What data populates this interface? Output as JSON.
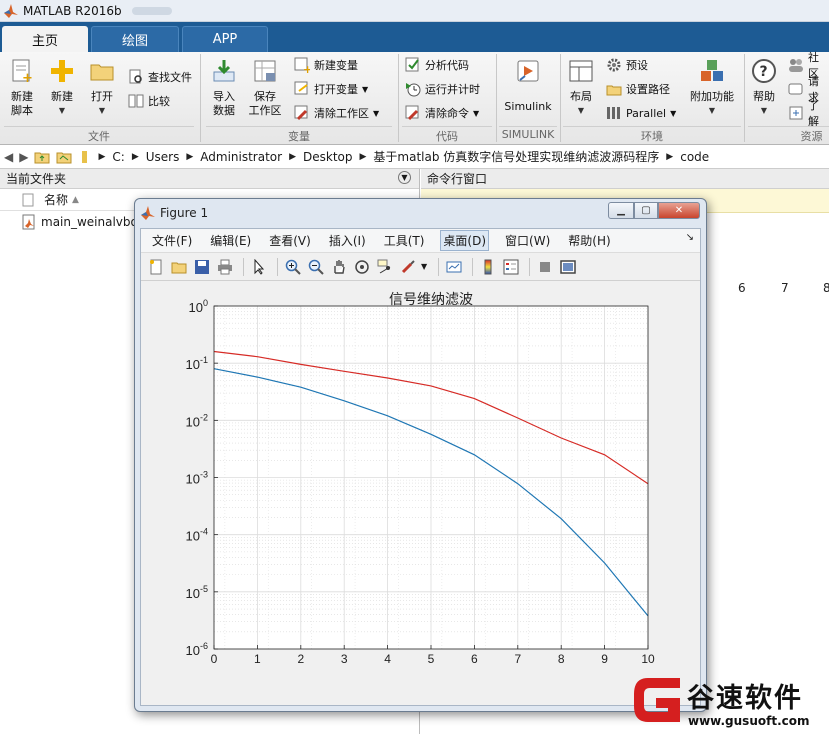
{
  "app": {
    "title": "MATLAB R2016b"
  },
  "tabs": [
    {
      "label": "主页"
    },
    {
      "label": "绘图"
    },
    {
      "label": "APP"
    }
  ],
  "ribbon": {
    "file": {
      "new_script": "新建\n脚本",
      "new": "新建",
      "open": "打开",
      "find_files": "查找文件",
      "compare": "比较",
      "label": "文件"
    },
    "variable": {
      "import_data": "导入\n数据",
      "save_workspace": "保存\n工作区",
      "new_variable": "新建变量",
      "open_variable": "打开变量",
      "clear_workspace": "清除工作区",
      "label": "变量"
    },
    "code": {
      "analyze_code": "分析代码",
      "run_and_time": "运行并计时",
      "clear_commands": "清除命令",
      "label": "代码"
    },
    "simulink": {
      "simulink": "Simulink",
      "label": "SIMULINK"
    },
    "environment": {
      "layout": "布局",
      "preferences": "预设",
      "set_path": "设置路径",
      "parallel": "Parallel",
      "addons": "附加功能",
      "label": "环境"
    },
    "resources": {
      "help": "帮助",
      "community": "社区",
      "request_support": "请求",
      "learn": "了解",
      "label": "资源"
    }
  },
  "addressbar": {
    "crumbs": [
      "C:",
      "Users",
      "Administrator",
      "Desktop",
      "基于matlab 仿真数字信号处理实现维纳滤波源码程序",
      "code"
    ]
  },
  "current_folder": {
    "title": "当前文件夹",
    "column_name": "名称",
    "files": [
      "main_weinalvbo"
    ]
  },
  "command_window": {
    "title": "命令行窗口",
    "numbers": [
      "6",
      "7",
      "8"
    ]
  },
  "figure": {
    "title": "Figure 1",
    "menu": [
      "文件(F)",
      "编辑(E)",
      "查看(V)",
      "插入(I)",
      "工具(T)",
      "桌面(D)",
      "窗口(W)",
      "帮助(H)"
    ],
    "highlighted_menu": 5
  },
  "chart_data": {
    "type": "line",
    "title": "信号维纳滤波",
    "xlabel": "",
    "ylabel": "",
    "xlim": [
      0,
      10
    ],
    "ylim": [
      1e-06,
      1
    ],
    "yscale": "log",
    "grid": "major and minor",
    "x_ticks": [
      "0",
      "1",
      "2",
      "3",
      "4",
      "5",
      "6",
      "7",
      "8",
      "9",
      "10"
    ],
    "y_ticks": [
      {
        "base": "10",
        "exp": "0"
      },
      {
        "base": "10",
        "exp": "-1"
      },
      {
        "base": "10",
        "exp": "-2"
      },
      {
        "base": "10",
        "exp": "-3"
      },
      {
        "base": "10",
        "exp": "-4"
      },
      {
        "base": "10",
        "exp": "-5"
      },
      {
        "base": "10",
        "exp": "-6"
      }
    ],
    "x": [
      0,
      1,
      2,
      3,
      4,
      5,
      6,
      7,
      8,
      9,
      10
    ],
    "series": [
      {
        "color": "#d62b26",
        "values": [
          0.16,
          0.13,
          0.095,
          0.072,
          0.055,
          0.04,
          0.024,
          0.011,
          0.0049,
          0.0025,
          0.00078
        ]
      },
      {
        "color": "#1f77b4",
        "values": [
          0.08,
          0.057,
          0.038,
          0.022,
          0.012,
          0.0057,
          0.0025,
          0.00078,
          0.00019,
          3.2e-05,
          3.8e-06
        ]
      }
    ]
  },
  "watermark": {
    "name": "谷速软件",
    "url": "www.gusuoft.com"
  },
  "colors": {
    "tab_bar": "#1d5b94",
    "accent_red": "#d62b26"
  }
}
